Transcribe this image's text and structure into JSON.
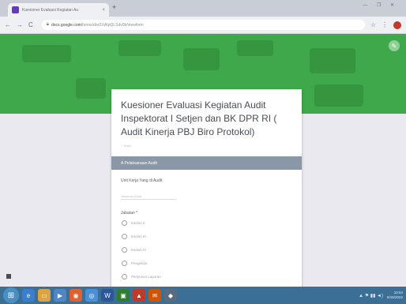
{
  "browser": {
    "tab_title": "Kuesioner Evaluasi Kegiatan Au",
    "tab_close": "×",
    "new_tab": "+",
    "window_controls": "— ❐ ✕",
    "nav_back": "←",
    "nav_forward": "→",
    "nav_reload": "C",
    "home": "⌂",
    "url_domain": "docs.google.com",
    "url_path": "/forms/d/e/1FAIpQLSdv0b/viewform",
    "star": "☆",
    "menu": "⋮"
  },
  "form": {
    "title": "Kuesioner Evaluasi Kegiatan Audit Inspektorat I Setjen dan BK DPR RI ( Audit Kinerja PBJ Biro Protokol)",
    "required_note": "* Wajib",
    "edit_icon": "✎",
    "section_title": "A Pelaksanaan Audit",
    "unit_label": "Unit Kerja Yang di Audit",
    "unit_placeholder": "Jawaban Anda",
    "jabatan_label": "Jabatan *",
    "options": [
      "Eselon II",
      "Eselon III",
      "Eselon IV",
      "Pengelola",
      "Penyusun Laporan"
    ]
  },
  "taskbar": {
    "start": "⊞",
    "apps": [
      {
        "glyph": "e",
        "color": "#3a7ecf"
      },
      {
        "glyph": "▭",
        "color": "#d9a441"
      },
      {
        "glyph": "▶",
        "color": "#4f86c6"
      },
      {
        "glyph": "◉",
        "color": "#e06030"
      },
      {
        "glyph": "◎",
        "color": "#4a90d9"
      },
      {
        "glyph": "W",
        "color": "#2b579a"
      },
      {
        "glyph": "▣",
        "color": "#2e7d32"
      },
      {
        "glyph": "▲",
        "color": "#c0392b"
      },
      {
        "glyph": "✉",
        "color": "#d35400"
      },
      {
        "glyph": "◆",
        "color": "#5a6b7d"
      }
    ],
    "tray_icons": "▲ ⚑ ▮▮ ◄)",
    "time": "10:04",
    "date": "8/15/2022"
  }
}
